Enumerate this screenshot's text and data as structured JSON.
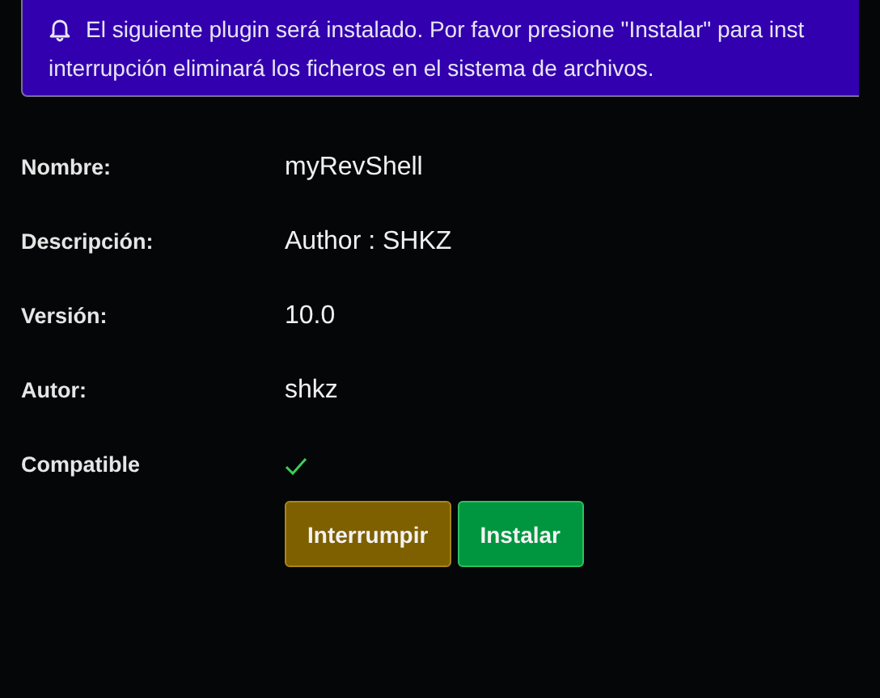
{
  "alert": {
    "lines": [
      "El siguiente plugin será instalado. Por favor presione \"Instalar\" para inst",
      "interrupción eliminará los ficheros en el sistema de archivos."
    ]
  },
  "fields": [
    {
      "label": "Nombre:",
      "value": "myRevShell"
    },
    {
      "label": "Descripción:",
      "value": "Author : SHKZ"
    },
    {
      "label": "Versión:",
      "value": "10.0"
    },
    {
      "label": "Autor:",
      "value": "shkz"
    }
  ],
  "compatible": {
    "label": "Compatible",
    "checked": true
  },
  "buttons": [
    {
      "label": "Interrumpir",
      "kind": "abort"
    },
    {
      "label": "Instalar",
      "kind": "install"
    }
  ]
}
